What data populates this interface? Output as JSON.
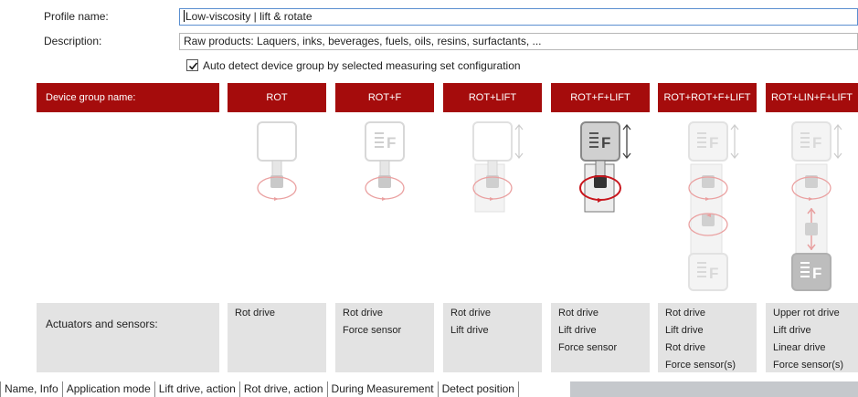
{
  "profile": {
    "name_label": "Profile name:",
    "name_value": "Low-viscosity  |  lift & rotate",
    "description_label": "Description:",
    "description_value": "Raw products: Laquers, inks, beverages, fuels,  oils, resins, surfactants, ..."
  },
  "auto_detect": {
    "checked": true,
    "label": "Auto detect device group by selected measuring set configuration"
  },
  "table": {
    "group_header": "Device group name:",
    "actuators_header": "Actuators and sensors:",
    "groups": [
      {
        "name": "ROT",
        "selected": false,
        "actuators": [
          "Rot drive"
        ]
      },
      {
        "name": "ROT+F",
        "selected": false,
        "actuators": [
          "Rot drive",
          "Force sensor"
        ]
      },
      {
        "name": "ROT+LIFT",
        "selected": false,
        "actuators": [
          "Rot drive",
          "Lift drive"
        ]
      },
      {
        "name": "ROT+F+LIFT",
        "selected": true,
        "actuators": [
          "Rot drive",
          "Lift drive",
          "Force sensor"
        ]
      },
      {
        "name": "ROT+ROT+F+LIFT",
        "selected": false,
        "actuators": [
          "Rot drive",
          "Lift drive",
          "Rot drive",
          "Force sensor(s)"
        ]
      },
      {
        "name": "ROT+LIN+F+LIFT",
        "selected": false,
        "actuators": [
          "Upper rot drive",
          "Lift drive",
          "Linear drive",
          "Force sensor(s)"
        ]
      }
    ]
  },
  "icons": {
    "force_glyph": "F",
    "checkmark": "check-icon"
  },
  "colors": {
    "header_red": "#a50c0c",
    "rotation_red": "#c8161d",
    "faded_red": "#eaa0a0",
    "actuator_gray": "#e3e3e3",
    "tab_fill": "#c5c8cc"
  },
  "tabs": [
    "Name, Info",
    "Application mode",
    "Lift drive, action",
    "Rot drive, action",
    "During Measurement",
    "Detect position"
  ]
}
